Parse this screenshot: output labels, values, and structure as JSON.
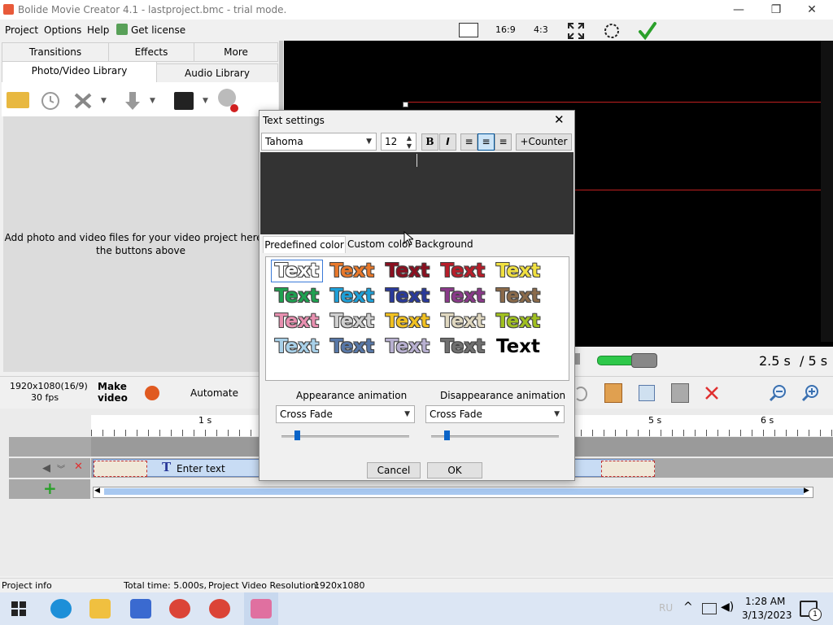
{
  "window": {
    "title": "Bolide Movie Creator 4.1 - lastproject.bmc  - trial mode.",
    "minimize": "—",
    "maximize": "❐",
    "close": "✕"
  },
  "menu": {
    "items": [
      "Project",
      "Options",
      "Help"
    ],
    "get_license": "Get license",
    "aspect_169": "16:9",
    "aspect_43": "4:3"
  },
  "left_tabs": {
    "row1": [
      "Transitions",
      "Effects",
      "More"
    ],
    "row2": [
      "Photo/Video Library",
      "Audio Library"
    ]
  },
  "library": {
    "hint_line1": "Add photo and video files for your video project here us",
    "hint_line2": "the buttons above"
  },
  "player": {
    "time_current": "2.5 s",
    "time_total": "/ 5 s",
    "volume": 0.75
  },
  "project": {
    "resolution": "1920x1080(16/9)",
    "fps": "30 fps",
    "make_video": [
      "Make",
      "video"
    ],
    "automate": "Automate"
  },
  "timeline": {
    "ruler_labels": [
      "1 s",
      "5 s",
      "6 s"
    ],
    "clip_label": "Enter text"
  },
  "status": {
    "project_info": "Project info",
    "total_time": "Total time: 5.000s,",
    "resolution": "Project Video Resolution:",
    "resolution_value": "1920x1080"
  },
  "dialog": {
    "title": "Text settings",
    "font": "Tahoma",
    "font_size": "12",
    "bold": "B",
    "italic": "I",
    "counter": "+Counter",
    "tabs": [
      "Predefined color",
      "Custom color",
      "Background"
    ],
    "swatch_text": "Text",
    "swatch_colors": [
      [
        "#ffffff",
        "#e8782a",
        "#8a1020",
        "#b81e2a",
        "#f0e040"
      ],
      [
        "#1fa050",
        "#1ea0d8",
        "#2a3a9a",
        "#8a3a8a",
        "#8a6a4a"
      ],
      [
        "#e890b0",
        "#d0d0d0",
        "#f0c020",
        "#e0d8c0",
        "#a0c020"
      ],
      [
        "#a8d0e8",
        "#5878a8",
        "#b8b0d0",
        "#707070",
        "#000000"
      ]
    ],
    "appearance_label": "Appearance animation",
    "disappearance_label": "Disappearance animation",
    "appearance_value": "Cross Fade",
    "disappearance_value": "Cross Fade",
    "cancel": "Cancel",
    "ok": "OK"
  },
  "taskbar": {
    "lang": "RU",
    "time": "1:28 AM",
    "date": "3/13/2023",
    "notif_count": "1"
  }
}
